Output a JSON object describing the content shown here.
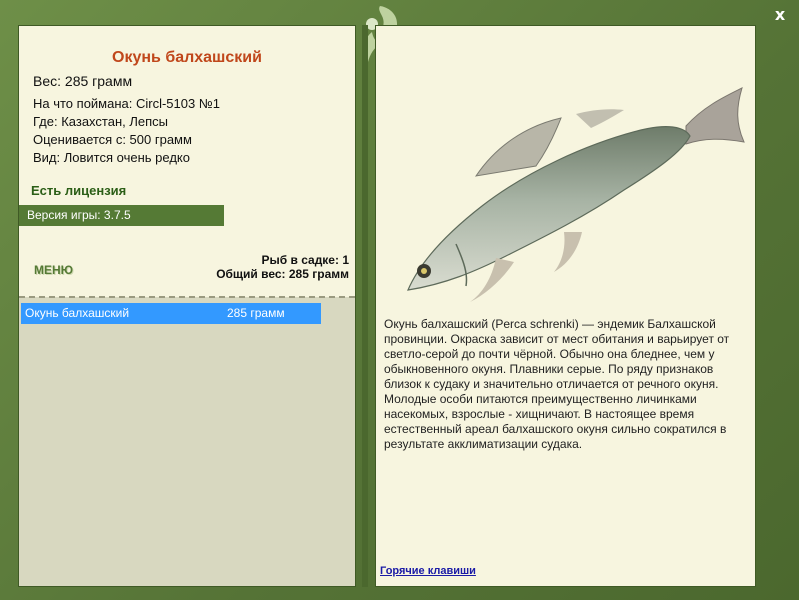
{
  "window": {
    "close_glyph": "x"
  },
  "fish": {
    "title": "Окунь балхашский",
    "weight": "Вес: 285 грамм",
    "bait": "На что поймана: Circl-5103 №1",
    "place": "Где: Казахстан, Лепсы",
    "value": "Оценивается с: 500 грамм",
    "rarity": "Вид: Ловится очень редко"
  },
  "license": "Есть лицензия",
  "version": "Версия игры: 3.7.5",
  "menu_label": "МЕНЮ",
  "stats": {
    "count": "Рыб в садке: 1",
    "total": "Общий вес: 285 грамм"
  },
  "catch_list": [
    {
      "name": "Окунь балхашский",
      "weight": "285 грамм"
    }
  ],
  "description": "Окунь балхашский (Perca schrenki) — эндемик Балхашской провинции. Окраска зависит от мест обитания и варьирует от светло-серой до почти чёрной. Обычно она бледнее, чем у обыкновенного окуня. Плавники серые. По ряду признаков близок к судаку и значительно отличается от речного окуня. Молодые особи питаются преимущественно личинками насекомых, взрослые - хищничают. В настоящее время естественный ареал балхашского окуня сильно сократился в результате акклиматизации судака.",
  "hotkeys_label": "Горячие клавиши",
  "icons": {
    "close": "close-icon",
    "logo": "leaf-logo-icon",
    "fish": "fish-image"
  },
  "colors": {
    "frame": "#5e7d3c",
    "title": "#c0471b",
    "selected": "#3399ff",
    "link": "#1a1aa6"
  }
}
